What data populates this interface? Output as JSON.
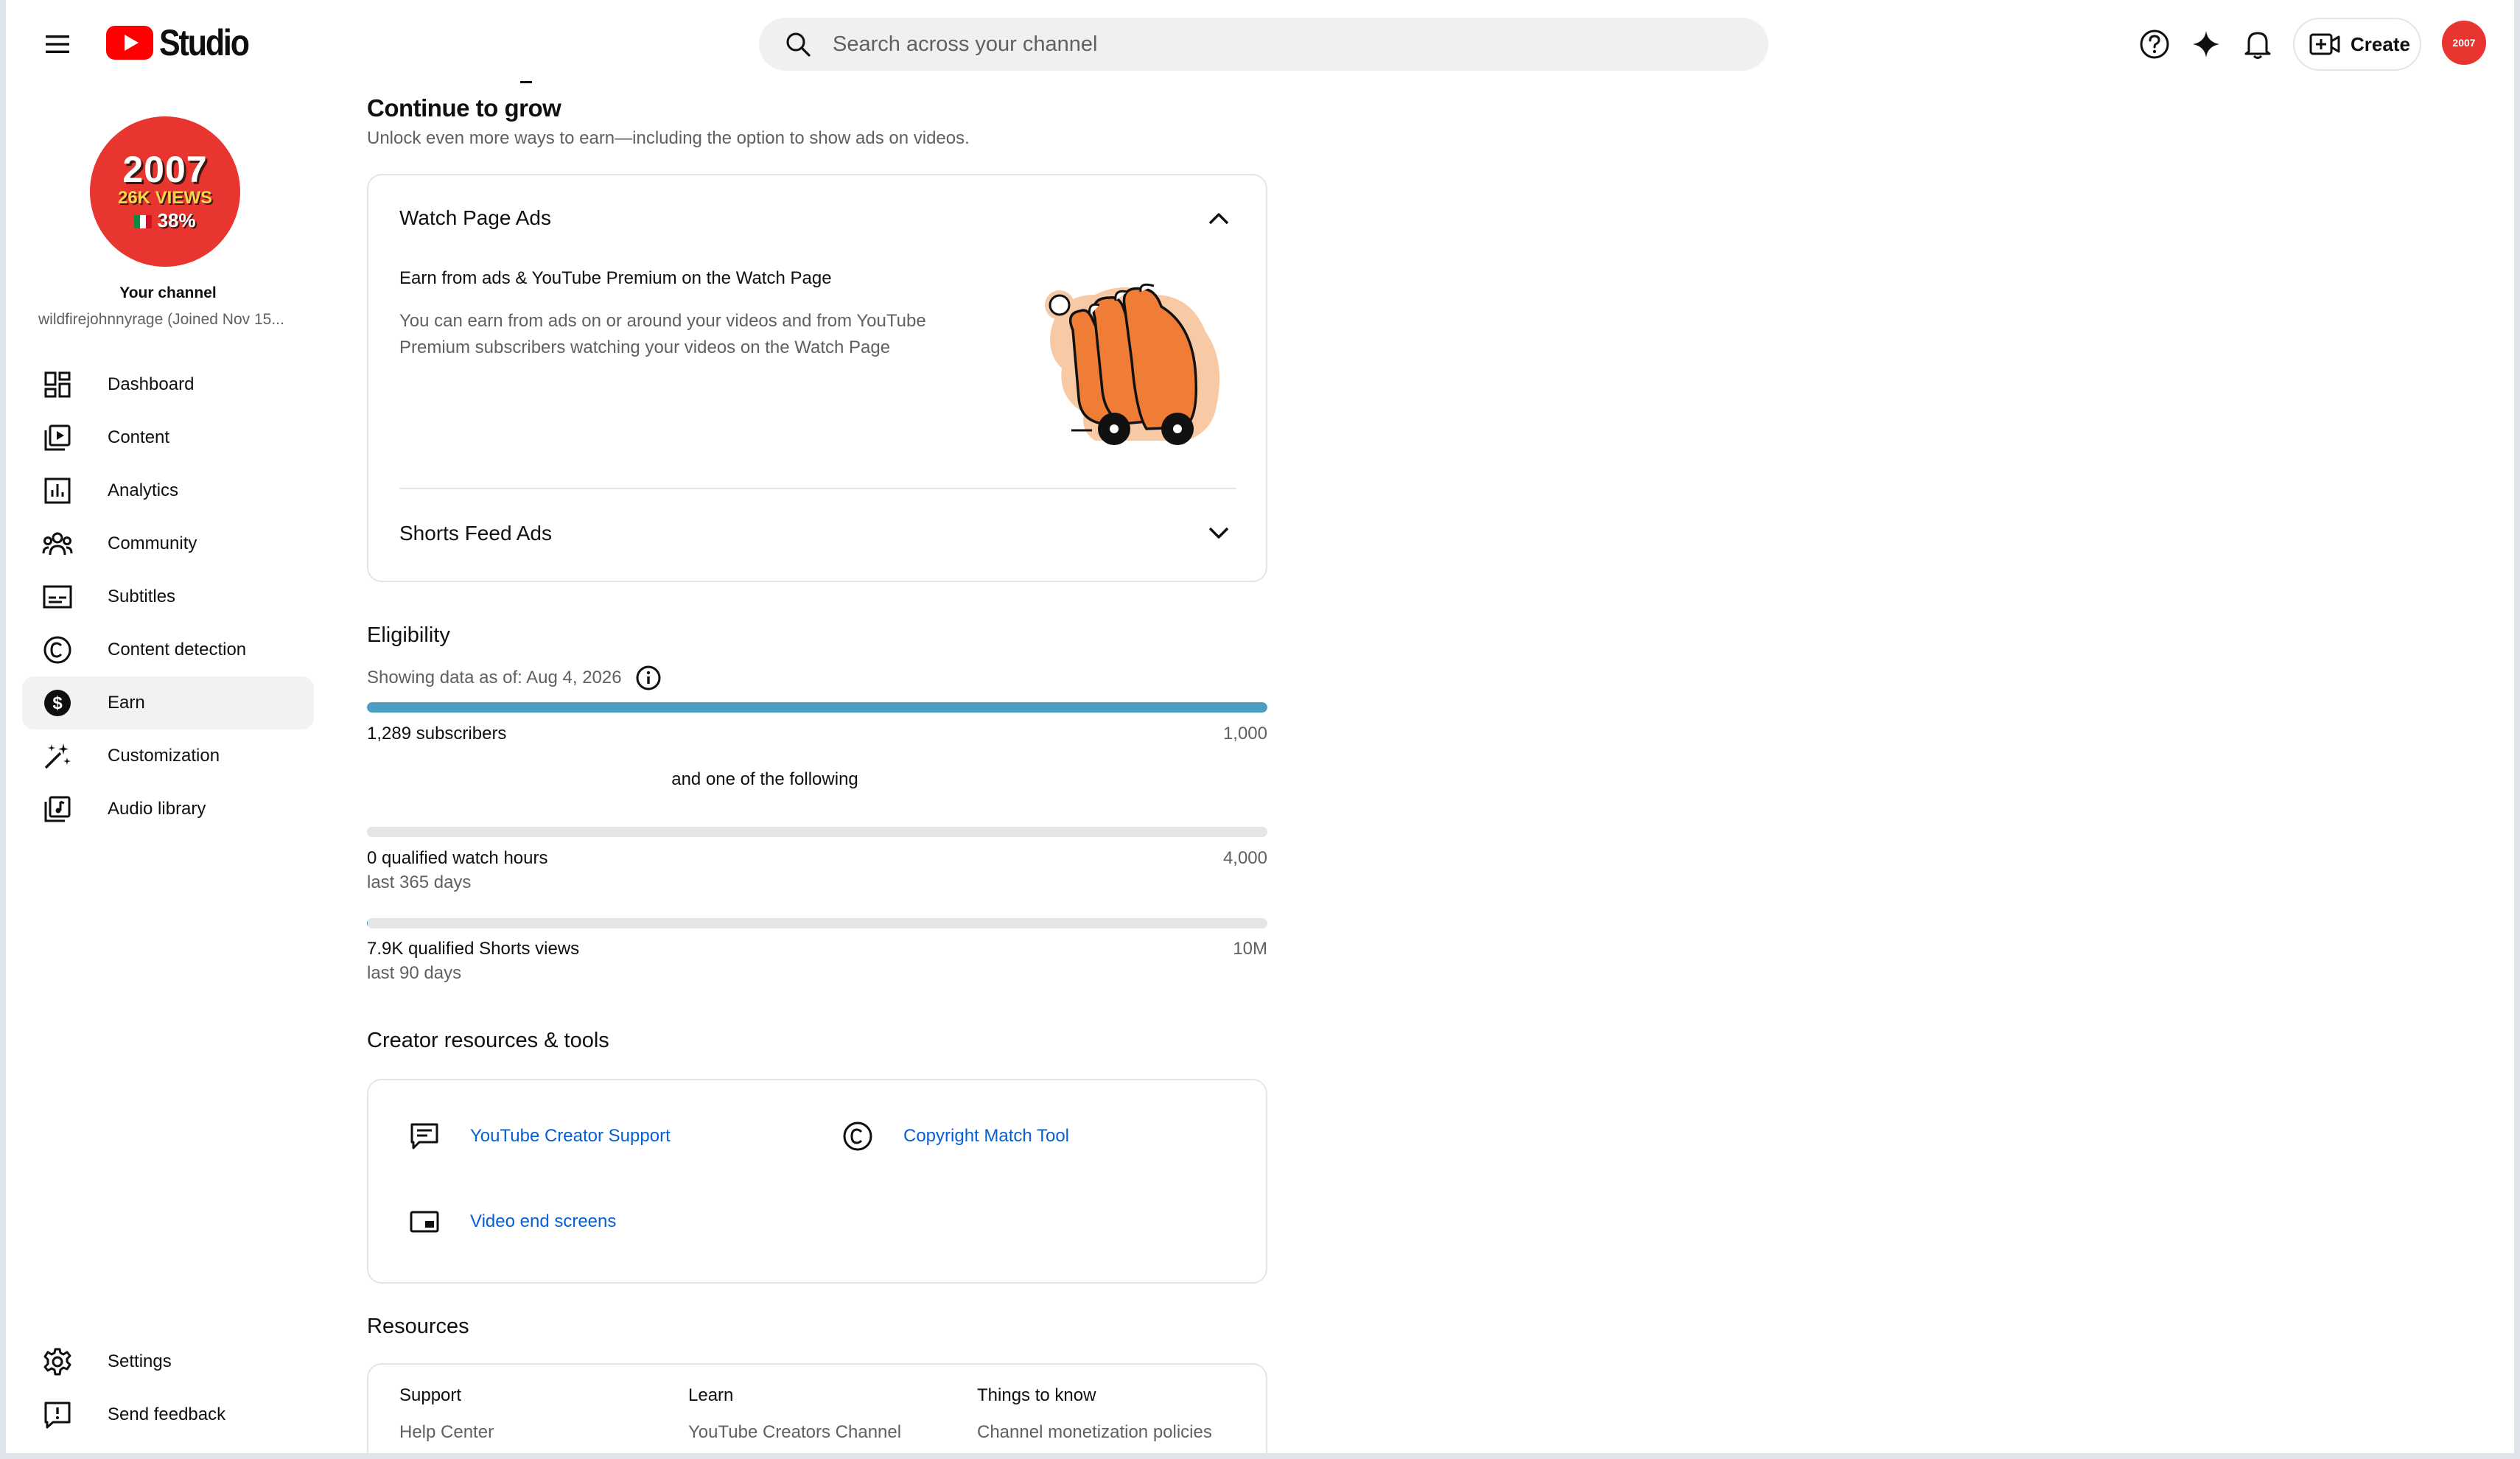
{
  "header": {
    "app_name": "Studio",
    "search_placeholder": "Search across your channel",
    "create_label": "Create",
    "avatar_text": "2007"
  },
  "channel": {
    "avatar_line1": "2007",
    "avatar_line2": "26K VIEWS",
    "avatar_line3": "38%",
    "title": "Your channel",
    "subtitle": "wildfirejohnnyrage (Joined Nov 15..."
  },
  "sidebar": {
    "items": [
      {
        "label": "Dashboard",
        "icon": "dashboard-icon"
      },
      {
        "label": "Content",
        "icon": "content-icon"
      },
      {
        "label": "Analytics",
        "icon": "analytics-icon"
      },
      {
        "label": "Community",
        "icon": "community-icon"
      },
      {
        "label": "Subtitles",
        "icon": "subtitles-icon"
      },
      {
        "label": "Content detection",
        "icon": "copyright-icon"
      },
      {
        "label": "Earn",
        "icon": "dollar-icon",
        "active": true
      },
      {
        "label": "Customization",
        "icon": "magic-wand-icon"
      },
      {
        "label": "Audio library",
        "icon": "audio-library-icon"
      }
    ],
    "bottom": [
      {
        "label": "Settings",
        "icon": "gear-icon"
      },
      {
        "label": "Send feedback",
        "icon": "feedback-icon"
      }
    ]
  },
  "grow": {
    "title": "Continue to grow",
    "subtitle": "Unlock even more ways to earn—including the option to show ads on videos.",
    "watch_ads": {
      "title": "Watch Page Ads",
      "heading": "Earn from ads & YouTube Premium on the Watch Page",
      "body": "You can earn from ads on or around your videos and from YouTube Premium subscribers watching your videos on the Watch Page"
    },
    "shorts_ads": {
      "title": "Shorts Feed Ads"
    }
  },
  "eligibility": {
    "title": "Eligibility",
    "date_label": "Showing data as of: Aug 4, 2026",
    "subscribers": {
      "label": "1,289 subscribers",
      "target": "1,000",
      "progress": 1.0
    },
    "or_text": "and one of the following",
    "watch_hours": {
      "label": "0 qualified watch hours",
      "period": "last 365 days",
      "target": "4,000",
      "progress": 0.0
    },
    "shorts_views": {
      "label": "7.9K qualified Shorts views",
      "period": "last 90 days",
      "target": "10M",
      "progress": 0.0008
    }
  },
  "tools": {
    "title": "Creator resources & tools",
    "items": [
      {
        "label": "YouTube Creator Support",
        "icon": "chat-icon"
      },
      {
        "label": "Copyright Match Tool",
        "icon": "copyright-icon"
      },
      {
        "label": "Video end screens",
        "icon": "end-screen-icon"
      }
    ]
  },
  "resources": {
    "title": "Resources",
    "columns": [
      {
        "heading": "Support",
        "link": "Help Center"
      },
      {
        "heading": "Learn",
        "link": "YouTube Creators Channel"
      },
      {
        "heading": "Things to know",
        "link": "Channel monetization policies"
      }
    ]
  },
  "colors": {
    "accent_link": "#065fd4",
    "progress_fill": "#4b9fc2",
    "brand_red": "#ff0000",
    "avatar_red": "#e8352f"
  }
}
